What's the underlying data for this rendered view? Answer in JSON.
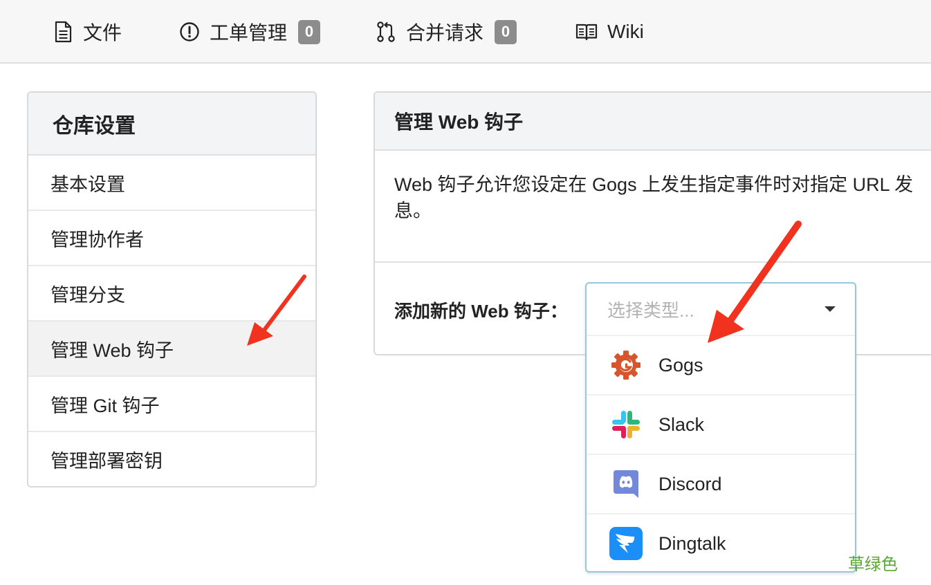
{
  "tabs": [
    {
      "label": "文件",
      "icon": "file-text-icon"
    },
    {
      "label": "工单管理",
      "icon": "issue-opened-icon",
      "count": "0"
    },
    {
      "label": "合并请求",
      "icon": "git-pull-request-icon",
      "count": "0"
    },
    {
      "label": "Wiki",
      "icon": "book-icon"
    }
  ],
  "sidebar": {
    "title": "仓库设置",
    "items": [
      {
        "label": "基本设置"
      },
      {
        "label": "管理协作者"
      },
      {
        "label": "管理分支"
      },
      {
        "label": "管理 Web 钩子",
        "active": true
      },
      {
        "label": "管理 Git 钩子"
      },
      {
        "label": "管理部署密钥"
      }
    ]
  },
  "panel": {
    "title": "管理 Web 钩子",
    "description_line1": "Web 钩子允许您设定在 Gogs 上发生指定事件时对指定 URL 发",
    "description_line2": "息。",
    "add_label": "添加新的 Web 钩子："
  },
  "dropdown": {
    "placeholder": "选择类型...",
    "options": [
      {
        "label": "Gogs",
        "icon": "gogs-logo-icon"
      },
      {
        "label": "Slack",
        "icon": "slack-logo-icon"
      },
      {
        "label": "Discord",
        "icon": "discord-logo-icon"
      },
      {
        "label": "Dingtalk",
        "icon": "dingtalk-logo-icon"
      }
    ]
  },
  "annotation_color": "#f0321e",
  "accent_border": "#96c8da",
  "watermark": "草绿色"
}
